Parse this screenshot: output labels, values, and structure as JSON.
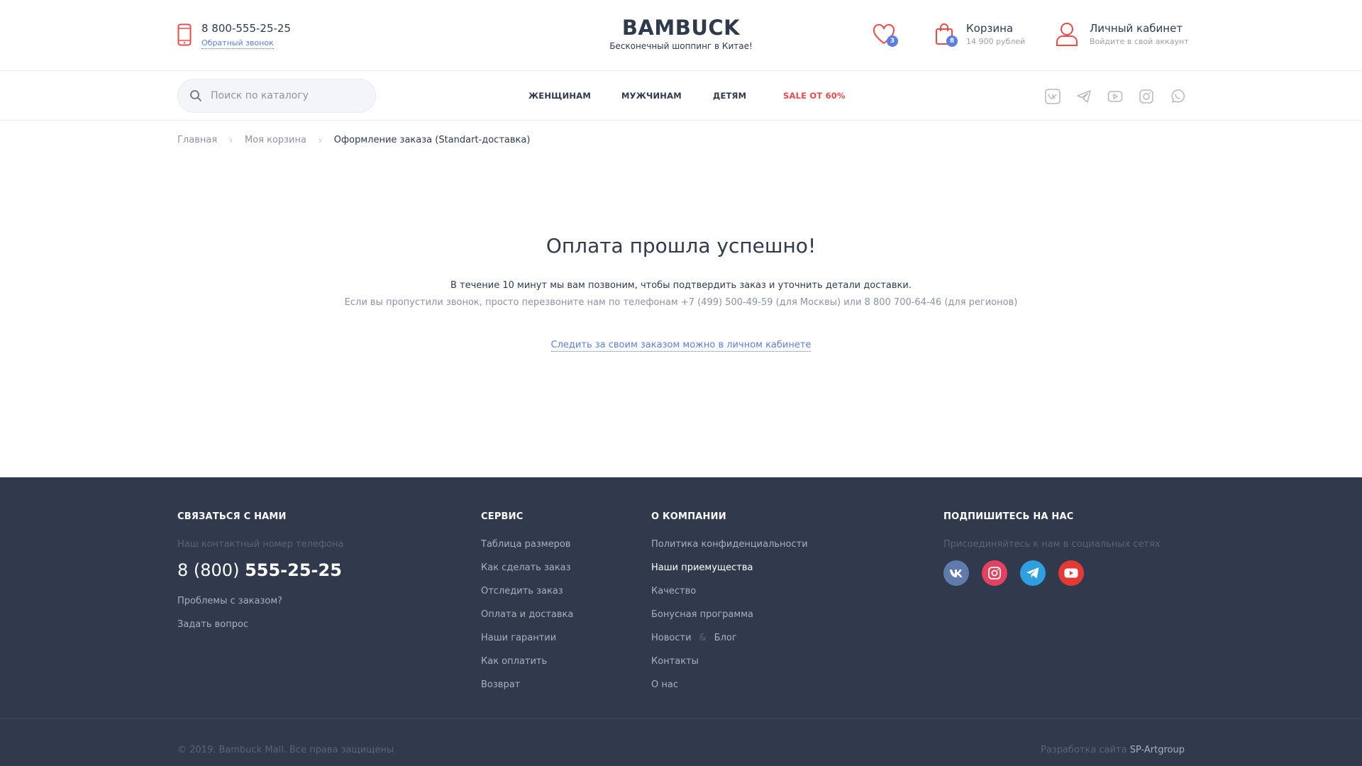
{
  "header": {
    "phone": "8 800-555-25-25",
    "callback": "Обратный звонок",
    "logo": "BAMBUCK",
    "tagline": "Бесконечный шоппинг в Китае!",
    "favorites_count": "3",
    "cart": {
      "title": "Корзина",
      "count": "8",
      "total": "14 900 рублей"
    },
    "account": {
      "title": "Личный кабинет",
      "subtitle": "Войдите в свой аккаунт"
    }
  },
  "nav": {
    "search_placeholder": "Поиск по каталогу",
    "items": [
      "ЖЕНЩИНАМ",
      "МУЖЧИНАМ",
      "ДЕТЯМ",
      "SALE ОТ 60%"
    ],
    "social_icons": [
      "vk-icon",
      "telegram-icon",
      "youtube-icon",
      "instagram-icon",
      "whatsapp-icon"
    ]
  },
  "breadcrumb": [
    "Главная",
    "Моя корзина",
    "Оформление заказа (Standart-доставка)"
  ],
  "main": {
    "title": "Оплата прошла успешно!",
    "line1": "В течение 10 минут мы вам позвоним, чтобы подтвердить заказ и уточнить детали доставки.",
    "line2": "Если вы пропустили звонок, просто перезвоните нам по телефонам +7 (499) 500-49-59 (для Москвы) или 8 800 700-64-46 (для регионов)",
    "track_link": "Следить за своим заказом можно в личном кабинете"
  },
  "footer": {
    "contact": {
      "title": "СВЯЗАТЬСЯ С НАМИ",
      "hint": "Наш контактный номер телефона",
      "phone_prefix": "8 (800)",
      "phone_main": "555-25-25",
      "links": [
        "Проблемы с заказом?",
        "Задать вопрос"
      ]
    },
    "service": {
      "title": "СЕРВИС",
      "links": [
        "Таблица размеров",
        "Как сделать заказ",
        "Отследить заказ",
        "Оплата и доставка",
        "Наши гарантии",
        "Как оплатить",
        "Возврат"
      ]
    },
    "company": {
      "title": "О КОМПАНИИ",
      "links": [
        "Политика конфиденциальности",
        "Наши приемущества",
        "Качество",
        "Бонусная программа"
      ],
      "news": "Новости",
      "amp": "&",
      "blog": "Блог",
      "links2": [
        "Контакты",
        "О нас"
      ]
    },
    "subscribe": {
      "title": "ПОДПИШИТЕСЬ НА НАС",
      "hint": "Присоединяйтесь к нам в социальных сетях",
      "icons": [
        "vk-icon",
        "instagram-icon",
        "telegram-icon",
        "youtube-icon"
      ]
    },
    "copyright": "© 2019. Bambuck Mall. Все права защищены",
    "dev_label": "Разработка сайта",
    "dev_name": "SP-Artgroup"
  },
  "colors": {
    "accent_red": "#ee4a4a",
    "accent_blue": "#5b7fe0",
    "footer_bg": "#313a4d",
    "text": "#2f3a4d"
  }
}
